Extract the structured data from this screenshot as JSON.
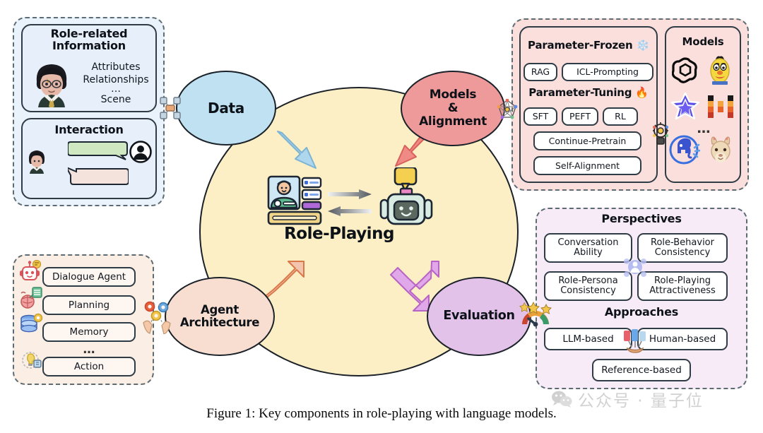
{
  "figure": {
    "caption": "Figure 1: Key components in role-playing with language models.",
    "center_label": "Role-Playing"
  },
  "watermark": {
    "text": "公众号 · 量子位",
    "icon": "wechat-icon"
  },
  "nodes": [
    {
      "id": "data",
      "label": "Data",
      "color": "#bfe1f2"
    },
    {
      "id": "models",
      "label": "Models\n&\nAlignment",
      "color": "#ef9a9a"
    },
    {
      "id": "agent",
      "label": "Agent\nArchitecture",
      "color": "#f7ded0"
    },
    {
      "id": "eval",
      "label": "Evaluation",
      "color": "#e3c2ea"
    }
  ],
  "node_labels": {
    "data": "Data",
    "models_line1": "Models",
    "models_line2": "&",
    "models_line3": "Alignment",
    "agent_line1": "Agent",
    "agent_line2": "Architecture",
    "eval": "Evaluation"
  },
  "data_panel": {
    "role_info": {
      "title_line1": "Role-related",
      "title_line2": "Information",
      "items": [
        "Attributes",
        "Relationships",
        "…",
        "Scene"
      ],
      "avatar_icon": "wizard-character-avatar-icon"
    },
    "interaction": {
      "title": "Interaction",
      "user_icon": "user-avatar-icon",
      "character_icon": "character-avatar-icon",
      "bubbles": [
        {
          "speaker": "user",
          "color": "#cfe8c2"
        },
        {
          "speaker": "character",
          "color": "#f4e3dc"
        }
      ]
    }
  },
  "models_panel": {
    "parameter_frozen": {
      "title": "Parameter-Frozen",
      "icon": "snowflake-icon",
      "items": [
        "RAG",
        "ICL-Prompting"
      ]
    },
    "parameter_tuning": {
      "title": "Parameter-Tuning",
      "icon": "fire-icon",
      "items": [
        "SFT",
        "PEFT",
        "RL",
        "Continue-Pretrain",
        "Self-Alignment"
      ]
    },
    "models": {
      "title": "Models",
      "ellipsis": "…",
      "logos": [
        "openai-logo-icon",
        "bert-muppet-icon",
        "purple-star-model-logo-icon",
        "mistral-pixel-logo-icon",
        "blue-elephant-model-logo-icon",
        "llama-model-icon"
      ]
    }
  },
  "evaluation_panel": {
    "perspectives": {
      "title": "Perspectives",
      "items": [
        "Conversation\nAbility",
        "Role-Behavior\nConsistency",
        "Role-Persona\nConsistency",
        "Role-Playing\nAttractiveness"
      ],
      "item_lines": [
        [
          "Conversation",
          "Ability"
        ],
        [
          "Role-Behavior",
          "Consistency"
        ],
        [
          "Role-Persona",
          "Consistency"
        ],
        [
          "Role-Playing",
          "Attractiveness"
        ]
      ],
      "center_icon": "user-network-icon"
    },
    "approaches": {
      "title": "Approaches",
      "items": [
        "LLM-based",
        "Human-based",
        "Reference-based"
      ],
      "center_icon": "voting-hand-icon"
    },
    "gauge_icon": "rating-gauge-icon"
  },
  "agent_panel": {
    "items": [
      "Dialogue Agent",
      "Planning",
      "Memory",
      "…",
      "Action"
    ],
    "icons": [
      "chat-robot-icon",
      "brain-planning-icon",
      "database-memory-icon",
      "lightbulb-action-icon"
    ],
    "connector_icon": "gears-in-hands-icon"
  },
  "connectors": {
    "data_chip_icon": "processor-chip-icon",
    "models_chip_icon": "neural-network-icon",
    "models_inner_icon": "robot-head-icon"
  },
  "center": {
    "human_icon": "human-profile-card-icon",
    "robot_icon": "robot-chat-icon",
    "arrow_right_icon": "arrow-right-icon",
    "arrow_left_icon": "arrow-left-icon"
  },
  "arrows": [
    {
      "from": "data",
      "to": "center",
      "color": "#aed6ec",
      "direction": "one-way"
    },
    {
      "from": "models",
      "to": "center",
      "color": "#f08a84",
      "direction": "one-way"
    },
    {
      "from": "agent",
      "to": "center",
      "color": "#f3c5ae",
      "direction": "two-way"
    },
    {
      "from": "eval",
      "to": "center",
      "color": "#e0a8e8",
      "direction": "two-way"
    }
  ]
}
